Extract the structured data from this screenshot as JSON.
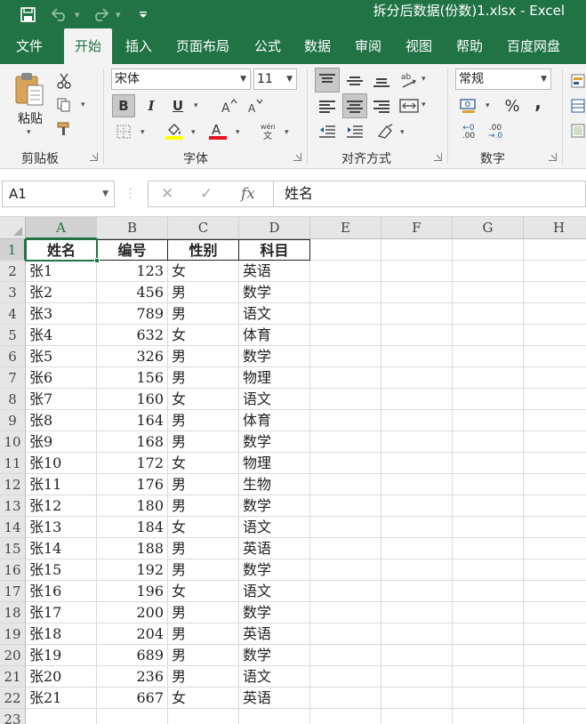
{
  "window": {
    "title": "拆分后数据(份数)1.xlsx  -  Excel"
  },
  "quick_access": {
    "save_icon": "save-icon",
    "undo_icon": "undo-icon",
    "redo_icon": "redo-icon",
    "customize_icon": "customize-icon"
  },
  "tabs": [
    {
      "label": "文件",
      "active": false
    },
    {
      "label": "开始",
      "active": true
    },
    {
      "label": "插入",
      "active": false
    },
    {
      "label": "页面布局",
      "active": false
    },
    {
      "label": "公式",
      "active": false
    },
    {
      "label": "数据",
      "active": false
    },
    {
      "label": "审阅",
      "active": false
    },
    {
      "label": "视图",
      "active": false
    },
    {
      "label": "帮助",
      "active": false
    },
    {
      "label": "百度网盘",
      "active": false
    }
  ],
  "ribbon": {
    "clipboard": {
      "label": "剪贴板",
      "paste_label": "粘贴"
    },
    "font": {
      "label": "字体",
      "font_name": "宋体",
      "font_size": "11",
      "bold": "B",
      "italic": "I",
      "underline": "U",
      "phonetic": "wén",
      "font_color_letter": "A",
      "fill_color": "#ffff00",
      "font_color": "#e81123"
    },
    "alignment": {
      "label": "对齐方式"
    },
    "number": {
      "label": "数字",
      "format": "常规",
      "percent": "%",
      "comma": ",",
      "inc_decimal": ".00",
      "dec_decimal": ".00"
    }
  },
  "formula_bar": {
    "name_box": "A1",
    "fx": "fx",
    "value": "姓名"
  },
  "sheet": {
    "columns": [
      "A",
      "B",
      "C",
      "D",
      "E",
      "F",
      "G",
      "H"
    ],
    "header": [
      "姓名",
      "编号",
      "性别",
      "科目"
    ],
    "rows": [
      [
        "张1",
        "123",
        "女",
        "英语"
      ],
      [
        "张2",
        "456",
        "男",
        "数学"
      ],
      [
        "张3",
        "789",
        "男",
        "语文"
      ],
      [
        "张4",
        "632",
        "女",
        "体育"
      ],
      [
        "张5",
        "326",
        "男",
        "数学"
      ],
      [
        "张6",
        "156",
        "男",
        "物理"
      ],
      [
        "张7",
        "160",
        "女",
        "语文"
      ],
      [
        "张8",
        "164",
        "男",
        "体育"
      ],
      [
        "张9",
        "168",
        "男",
        "数学"
      ],
      [
        "张10",
        "172",
        "女",
        "物理"
      ],
      [
        "张11",
        "176",
        "男",
        "生物"
      ],
      [
        "张12",
        "180",
        "男",
        "数学"
      ],
      [
        "张13",
        "184",
        "女",
        "语文"
      ],
      [
        "张14",
        "188",
        "男",
        "英语"
      ],
      [
        "张15",
        "192",
        "男",
        "数学"
      ],
      [
        "张16",
        "196",
        "女",
        "语文"
      ],
      [
        "张17",
        "200",
        "男",
        "数学"
      ],
      [
        "张18",
        "204",
        "男",
        "英语"
      ],
      [
        "张19",
        "689",
        "男",
        "数学"
      ],
      [
        "张20",
        "236",
        "男",
        "语文"
      ],
      [
        "张21",
        "667",
        "女",
        "英语"
      ]
    ],
    "row_numbers": [
      "1",
      "2",
      "3",
      "4",
      "5",
      "6",
      "7",
      "8",
      "9",
      "10",
      "11",
      "12",
      "13",
      "14",
      "15",
      "16",
      "17",
      "18",
      "19",
      "20",
      "21",
      "22",
      "23"
    ],
    "selected_cell": "A1",
    "accent": "#217346"
  }
}
